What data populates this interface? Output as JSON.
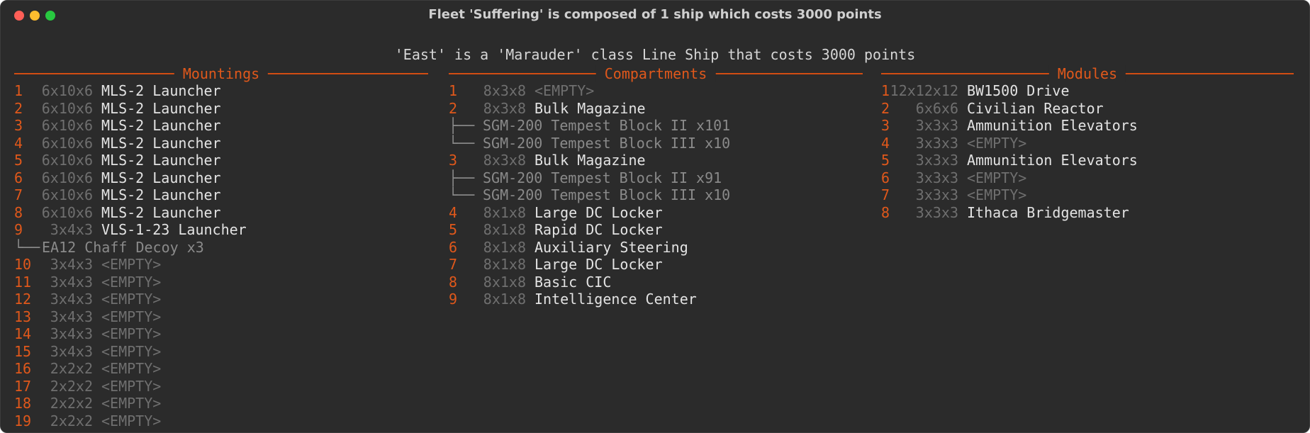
{
  "window": {
    "title": "Fleet 'Suffering' is composed of 1 ship which costs 3000 points"
  },
  "ship_title": "'East' is a 'Marauder' class Line Ship that costs 3000 points",
  "panels": {
    "mountings": {
      "title": "Mountings",
      "rows": [
        {
          "kind": "item",
          "num": "1",
          "size": "6x10x6",
          "name": "MLS-2 Launcher",
          "empty": false
        },
        {
          "kind": "item",
          "num": "2",
          "size": "6x10x6",
          "name": "MLS-2 Launcher",
          "empty": false
        },
        {
          "kind": "item",
          "num": "3",
          "size": "6x10x6",
          "name": "MLS-2 Launcher",
          "empty": false
        },
        {
          "kind": "item",
          "num": "4",
          "size": "6x10x6",
          "name": "MLS-2 Launcher",
          "empty": false
        },
        {
          "kind": "item",
          "num": "5",
          "size": "6x10x6",
          "name": "MLS-2 Launcher",
          "empty": false
        },
        {
          "kind": "item",
          "num": "6",
          "size": "6x10x6",
          "name": "MLS-2 Launcher",
          "empty": false
        },
        {
          "kind": "item",
          "num": "7",
          "size": "6x10x6",
          "name": "MLS-2 Launcher",
          "empty": false
        },
        {
          "kind": "item",
          "num": "8",
          "size": "6x10x6",
          "name": "MLS-2 Launcher",
          "empty": false
        },
        {
          "kind": "item",
          "num": "9",
          "size": "3x4x3",
          "name": "VLS-1-23 Launcher",
          "empty": false
        },
        {
          "kind": "sub",
          "tree": "└──",
          "name": "EA12 Chaff Decoy x3"
        },
        {
          "kind": "item",
          "num": "10",
          "size": "3x4x3",
          "name": "<EMPTY>",
          "empty": true
        },
        {
          "kind": "item",
          "num": "11",
          "size": "3x4x3",
          "name": "<EMPTY>",
          "empty": true
        },
        {
          "kind": "item",
          "num": "12",
          "size": "3x4x3",
          "name": "<EMPTY>",
          "empty": true
        },
        {
          "kind": "item",
          "num": "13",
          "size": "3x4x3",
          "name": "<EMPTY>",
          "empty": true
        },
        {
          "kind": "item",
          "num": "14",
          "size": "3x4x3",
          "name": "<EMPTY>",
          "empty": true
        },
        {
          "kind": "item",
          "num": "15",
          "size": "3x4x3",
          "name": "<EMPTY>",
          "empty": true
        },
        {
          "kind": "item",
          "num": "16",
          "size": "2x2x2",
          "name": "<EMPTY>",
          "empty": true
        },
        {
          "kind": "item",
          "num": "17",
          "size": "2x2x2",
          "name": "<EMPTY>",
          "empty": true
        },
        {
          "kind": "item",
          "num": "18",
          "size": "2x2x2",
          "name": "<EMPTY>",
          "empty": true
        },
        {
          "kind": "item",
          "num": "19",
          "size": "2x2x2",
          "name": "<EMPTY>",
          "empty": true
        }
      ]
    },
    "compartments": {
      "title": "Compartments",
      "rows": [
        {
          "kind": "item",
          "num": "1",
          "size": "8x3x8",
          "name": "<EMPTY>",
          "empty": true
        },
        {
          "kind": "item",
          "num": "2",
          "size": "8x3x8",
          "name": "Bulk Magazine",
          "empty": false
        },
        {
          "kind": "sub",
          "tree": "├──",
          "name": "SGM-200 Tempest Block II x101"
        },
        {
          "kind": "sub",
          "tree": "└──",
          "name": "SGM-200 Tempest Block III x10"
        },
        {
          "kind": "item",
          "num": "3",
          "size": "8x3x8",
          "name": "Bulk Magazine",
          "empty": false
        },
        {
          "kind": "sub",
          "tree": "├──",
          "name": "SGM-200 Tempest Block II x91"
        },
        {
          "kind": "sub",
          "tree": "└──",
          "name": "SGM-200 Tempest Block III x10"
        },
        {
          "kind": "item",
          "num": "4",
          "size": "8x1x8",
          "name": "Large DC Locker",
          "empty": false
        },
        {
          "kind": "item",
          "num": "5",
          "size": "8x1x8",
          "name": "Rapid DC Locker",
          "empty": false
        },
        {
          "kind": "item",
          "num": "6",
          "size": "8x1x8",
          "name": "Auxiliary Steering",
          "empty": false
        },
        {
          "kind": "item",
          "num": "7",
          "size": "8x1x8",
          "name": "Large DC Locker",
          "empty": false
        },
        {
          "kind": "item",
          "num": "8",
          "size": "8x1x8",
          "name": "Basic CIC",
          "empty": false
        },
        {
          "kind": "item",
          "num": "9",
          "size": "8x1x8",
          "name": "Intelligence Center",
          "empty": false
        }
      ]
    },
    "modules": {
      "title": "Modules",
      "rows": [
        {
          "kind": "item",
          "num": "1",
          "size": "12x12x12",
          "name": "BW1500 Drive",
          "empty": false
        },
        {
          "kind": "item",
          "num": "2",
          "size": "6x6x6",
          "name": "Civilian Reactor",
          "empty": false
        },
        {
          "kind": "item",
          "num": "3",
          "size": "3x3x3",
          "name": "Ammunition Elevators",
          "empty": false
        },
        {
          "kind": "item",
          "num": "4",
          "size": "3x3x3",
          "name": "<EMPTY>",
          "empty": true
        },
        {
          "kind": "item",
          "num": "5",
          "size": "3x3x3",
          "name": "Ammunition Elevators",
          "empty": false
        },
        {
          "kind": "item",
          "num": "6",
          "size": "3x3x3",
          "name": "<EMPTY>",
          "empty": true
        },
        {
          "kind": "item",
          "num": "7",
          "size": "3x3x3",
          "name": "<EMPTY>",
          "empty": true
        },
        {
          "kind": "item",
          "num": "8",
          "size": "3x3x3",
          "name": "Ithaca Bridgemaster",
          "empty": false
        }
      ]
    }
  },
  "colors": {
    "background": "#2b2b2b",
    "accent": "#e0581b",
    "text": "#e3e3e3",
    "dim": "#6f6f6f",
    "sub": "#8a8a8a"
  }
}
